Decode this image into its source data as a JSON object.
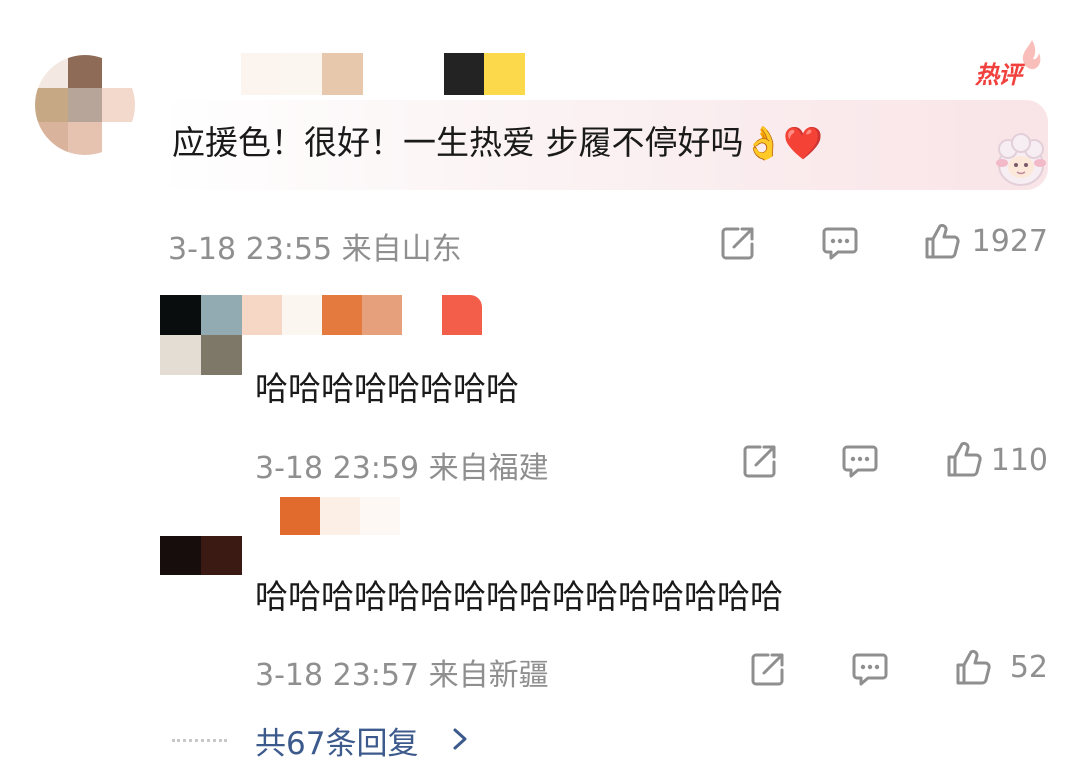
{
  "colors": {
    "meta_gray": "#8f8f8f",
    "link_blue": "#3c5a8c",
    "hot_red": "#f0413e",
    "heart_red": "#e8333a"
  },
  "hot_comment": {
    "badge": "热评",
    "text": "应援色！很好！一生热爱 步履不停好吗",
    "emojis": [
      "👌",
      "❤️"
    ],
    "time": "3-18 23:55",
    "location": "来自山东",
    "likes": "1927",
    "icons": [
      "share-icon",
      "comment-icon",
      "like-icon"
    ]
  },
  "replies": [
    {
      "text": "哈哈哈哈哈哈哈哈",
      "time": "3-18 23:59",
      "location": "来自福建",
      "likes": "110"
    },
    {
      "text": "哈哈哈哈哈哈哈哈哈哈哈哈哈哈哈哈",
      "time": "3-18 23:57",
      "location": "来自新疆",
      "likes": "52"
    }
  ],
  "more_replies_label": "共67条回复"
}
